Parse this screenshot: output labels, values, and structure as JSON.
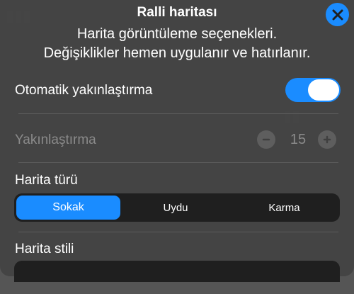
{
  "header": {
    "title": "Ralli haritası",
    "subtitle_line1": "Harita görüntüleme seçenekleri.",
    "subtitle_line2": "Değişiklikler hemen uygulanır ve hatırlanır."
  },
  "close_button": {
    "icon": "close-x-icon"
  },
  "auto_zoom": {
    "label": "Otomatik yakınlaştırma",
    "enabled": true
  },
  "zoom": {
    "label": "Yakınlaştırma",
    "value": "15",
    "minus_icon": "minus-icon",
    "plus_icon": "plus-icon",
    "disabled": true
  },
  "map_type": {
    "label": "Harita türü",
    "options": [
      "Sokak",
      "Uydu",
      "Karma"
    ],
    "selected": "Sokak"
  },
  "map_style": {
    "label": "Harita stili"
  },
  "colors": {
    "accent": "#1a8cff",
    "sheet": "#444444",
    "segment_bg": "#1f1f1f",
    "disabled_text": "#8a8a8a"
  }
}
